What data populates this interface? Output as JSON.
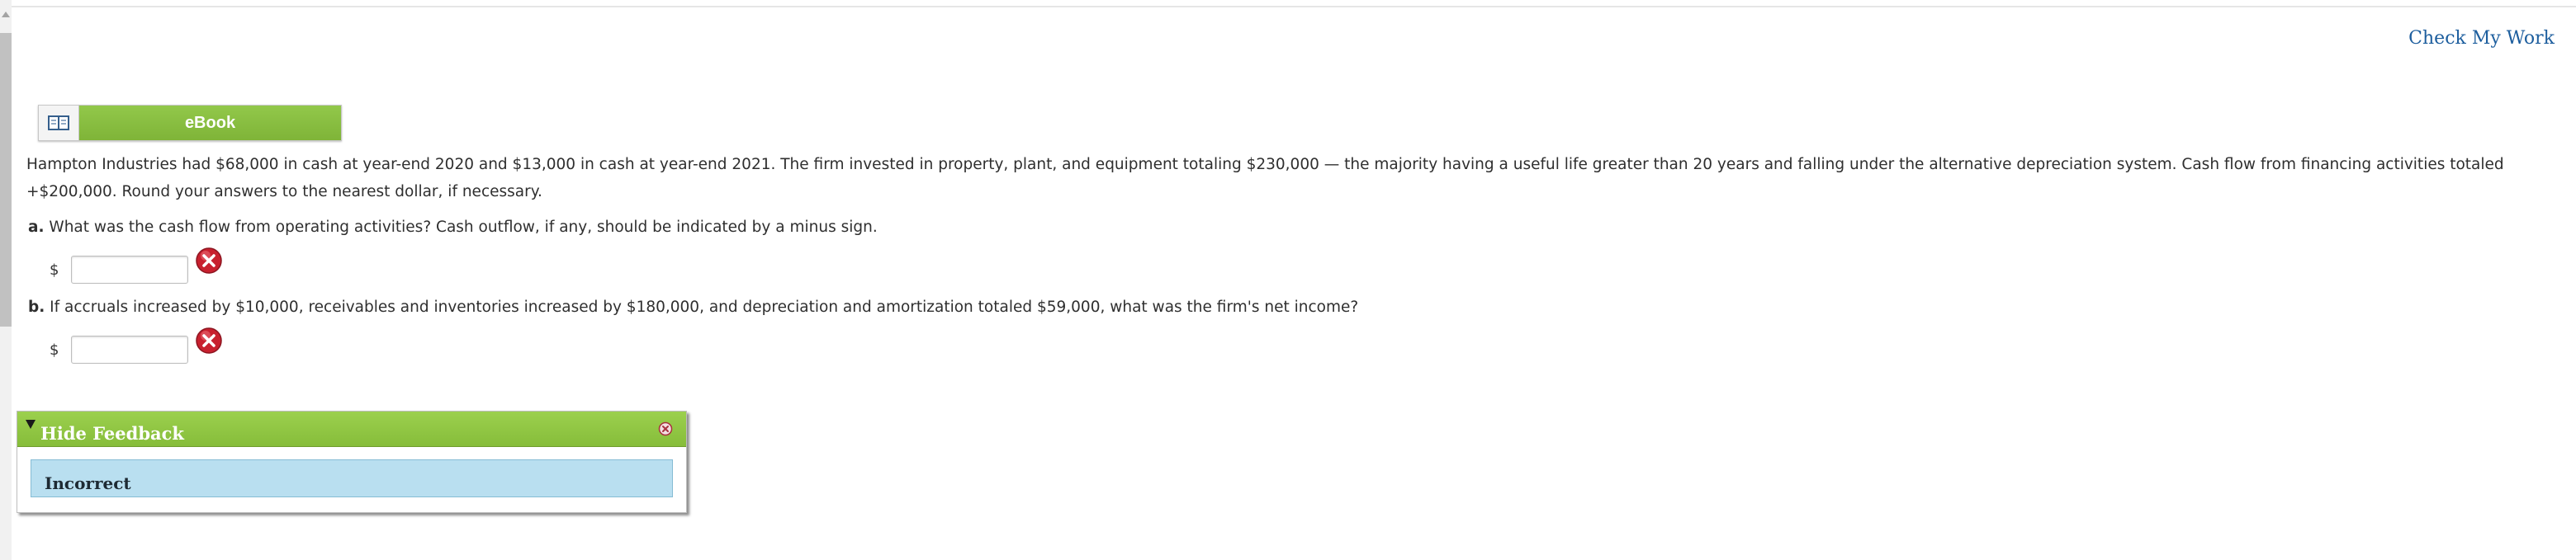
{
  "header": {
    "check_my_work": "Check My Work"
  },
  "ebook": {
    "label": "eBook",
    "icon": "book-icon"
  },
  "question": {
    "text": "Hampton Industries had $68,000 in cash at year-end 2020 and $13,000 in cash at year-end 2021. The firm invested in property, plant, and equipment totaling $230,000 — the majority having a useful life greater than 20 years and falling under the alternative depreciation system. Cash flow from financing activities totaled +$200,000. Round your answers to the nearest dollar, if necessary."
  },
  "parts": [
    {
      "letter": "a.",
      "text": "What was the cash flow from operating activities? Cash outflow, if any, should be indicated by a minus sign.",
      "currency": "$",
      "value": "",
      "status_icon": "incorrect-x-icon"
    },
    {
      "letter": "b.",
      "text": "If accruals increased by $10,000, receivables and inventories increased by $180,000, and depreciation and amortization totaled $59,000, what was the firm's net income?",
      "currency": "$",
      "value": "",
      "status_icon": "incorrect-x-icon"
    }
  ],
  "feedback": {
    "toggle_label": "Hide Feedback",
    "result": "Incorrect"
  },
  "colors": {
    "accent_green": "#8cc543",
    "link_blue": "#1d5e9e",
    "feedback_blue": "#b9dff0",
    "error_red": "#c8202e"
  }
}
